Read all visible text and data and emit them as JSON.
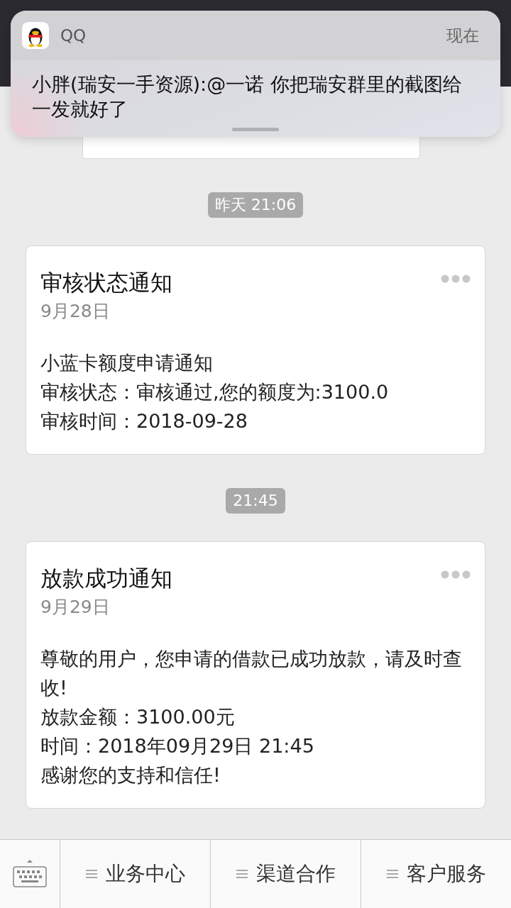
{
  "notification": {
    "app": "QQ",
    "time": "现在",
    "message": "小胖(瑞安一手资源):@一诺 你把瑞安群里的截图给一发就好了"
  },
  "messages": [
    {
      "time": "昨天 21:06",
      "title": "审核状态通知",
      "date": "9月28日",
      "lines": [
        "小蓝卡额度申请通知",
        "审核状态：审核通过,您的额度为:3100.0",
        "审核时间：2018-09-28"
      ]
    },
    {
      "time": "21:45",
      "title": "放款成功通知",
      "date": "9月29日",
      "lines": [
        "尊敬的用户，您申请的借款已成功放款，请及时查收!",
        "放款金额：3100.00元",
        "时间：2018年09月29日 21:45",
        "感谢您的支持和信任!"
      ]
    }
  ],
  "menu": [
    "业务中心",
    "渠道合作",
    "客户服务"
  ]
}
